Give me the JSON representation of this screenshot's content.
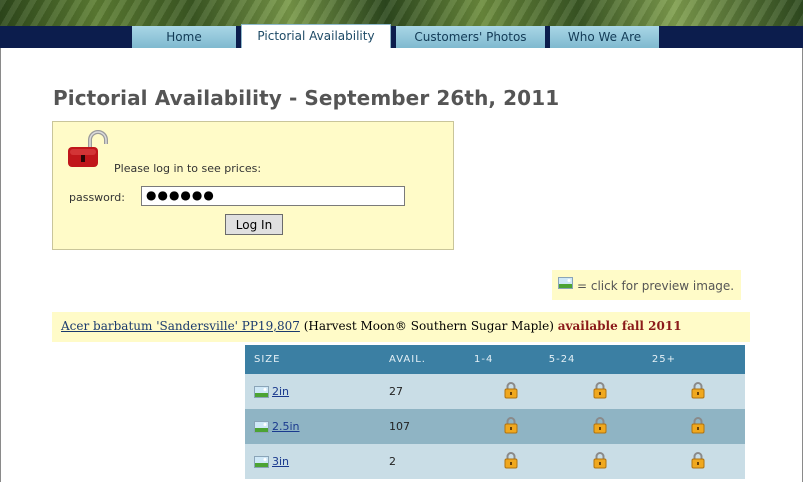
{
  "nav": {
    "tabs": [
      {
        "label": "Home"
      },
      {
        "label": "Pictorial Availability"
      },
      {
        "label": "Customers' Photos"
      },
      {
        "label": "Who We Are"
      }
    ],
    "active": "Pictorial Availability"
  },
  "page_title": "Pictorial Availability - September 26th, 2011",
  "login": {
    "message": "Please log in to see prices:",
    "password_label": "password:",
    "password_value": "●●●●●●",
    "button": "Log In"
  },
  "legend": {
    "text": "= click for preview image.",
    "icon": "preview-image-icon"
  },
  "plant": {
    "name": "Acer barbatum 'Sandersville' PP19,807",
    "common": " (Harvest Moon® Southern Sugar Maple) ",
    "availability": "available fall 2011"
  },
  "table": {
    "headers": {
      "size": "SIZE",
      "avail": "AVAIL.",
      "p1": "1-4",
      "p2": "5-24",
      "p3": "25+"
    },
    "rows": [
      {
        "size": "2in",
        "avail": "27"
      },
      {
        "size": "2.5in",
        "avail": "107"
      },
      {
        "size": "3in",
        "avail": "2"
      }
    ]
  },
  "colors": {
    "nav_bg": "#0c1d4d",
    "tab_bg": "#a9d6e6",
    "panel_bg": "#fffbc8",
    "table_header": "#3b7fa3",
    "row_light": "#c9dde6",
    "row_dark": "#8fb4c4",
    "available_text": "#8b1a1a"
  }
}
